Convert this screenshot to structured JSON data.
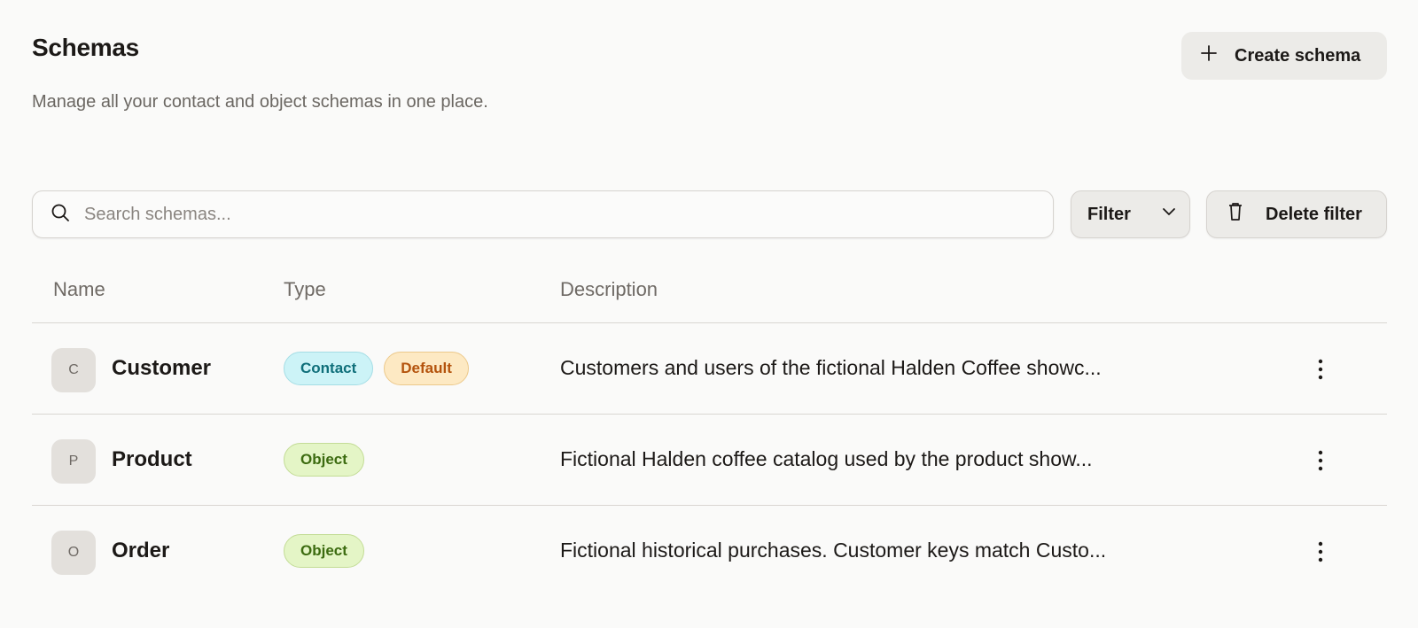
{
  "header": {
    "title": "Schemas",
    "subtitle": "Manage all your contact and object schemas in one place.",
    "create_button_label": "Create schema"
  },
  "toolbar": {
    "search_placeholder": "Search schemas...",
    "search_value": "",
    "filter_label": "Filter",
    "delete_filter_label": "Delete filter"
  },
  "table": {
    "columns": [
      "Name",
      "Type",
      "Description"
    ],
    "rows": [
      {
        "initial": "C",
        "name": "Customer",
        "badges": [
          "Contact",
          "Default"
        ],
        "description": "Customers and users of the fictional Halden Coffee showc..."
      },
      {
        "initial": "P",
        "name": "Product",
        "badges": [
          "Object"
        ],
        "description": "Fictional Halden coffee catalog used by the product show..."
      },
      {
        "initial": "O",
        "name": "Order",
        "badges": [
          "Object"
        ],
        "description": "Fictional historical purchases. Customer keys match Custo..."
      }
    ]
  },
  "icons": {
    "create": "plus-icon",
    "search": "search-icon",
    "filter": "chevron-down-icon",
    "delete": "trash-icon",
    "row_menu": "more-vertical-icon"
  },
  "colors": {
    "background": "#fafaf9",
    "contact_badge": "#ccf3f7",
    "default_badge": "#fde9c3",
    "object_badge": "#e4f5c6"
  }
}
